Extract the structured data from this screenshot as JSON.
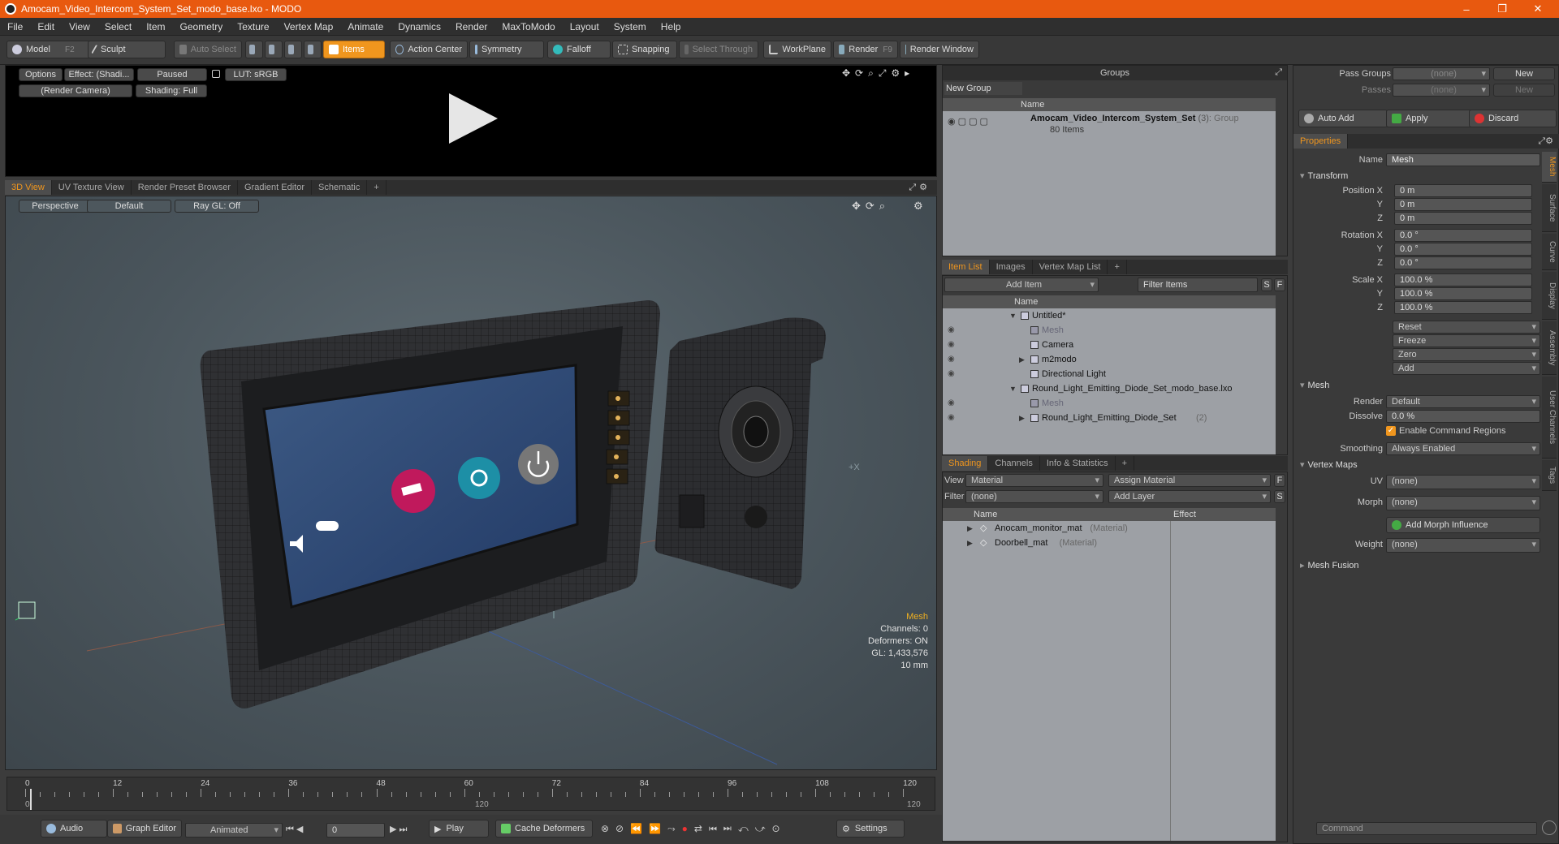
{
  "window": {
    "title": "Amocam_Video_Intercom_System_Set_modo_base.lxo - MODO",
    "minimize": "–",
    "maximize": "❐",
    "close": "✕"
  },
  "menu": [
    "File",
    "Edit",
    "View",
    "Select",
    "Item",
    "Geometry",
    "Texture",
    "Vertex Map",
    "Animate",
    "Dynamics",
    "Render",
    "MaxToModo",
    "Layout",
    "System",
    "Help"
  ],
  "toolbar": {
    "model": "Model",
    "model_key": "F2",
    "sculpt": "Sculpt",
    "auto_select": "Auto Select",
    "items": "Items",
    "action_center": "Action Center",
    "symmetry": "Symmetry",
    "falloff": "Falloff",
    "snapping": "Snapping",
    "select_through": "Select Through",
    "workplane": "WorkPlane",
    "render": "Render",
    "render_key": "F9",
    "render_window": "Render Window"
  },
  "preview": {
    "options": "Options",
    "effect": "Effect: (Shadi...",
    "paused": "Paused",
    "lut": "LUT: sRGB",
    "camera": "(Render Camera)",
    "shading": "Shading: Full"
  },
  "viewport_tabs": [
    "3D View",
    "UV Texture View",
    "Render Preset Browser",
    "Gradient Editor",
    "Schematic",
    "+"
  ],
  "viewport": {
    "projection": "Perspective",
    "style": "Default",
    "raygl": "Ray GL: Off",
    "marker": "+X",
    "info": {
      "title": "Mesh",
      "channels": "Channels: 0",
      "deformers": "Deformers: ON",
      "gl": "GL: 1,433,576",
      "scale": "10 mm"
    }
  },
  "screen_icons": {
    "mute": "Mute",
    "camera": "Camera",
    "settings": "Settings",
    "power": "Power"
  },
  "timeline": {
    "ticks": [
      "0",
      "12",
      "24",
      "36",
      "48",
      "60",
      "72",
      "84",
      "96",
      "108",
      "120"
    ],
    "bottom_ticks": [
      "0",
      "120",
      "120"
    ]
  },
  "bottombar": {
    "audio": "Audio",
    "graph_editor": "Graph Editor",
    "animated": "Animated",
    "frame": "0",
    "play": "Play",
    "cache_deformers": "Cache Deformers",
    "settings": "Settings"
  },
  "groups": {
    "title": "Groups",
    "new_group": "New Group",
    "col_name": "Name",
    "item_name": "Amocam_Video_Intercom_System_Set",
    "item_count": "(3)",
    "item_type": ": Group",
    "item_sub": "80 Items"
  },
  "itemlist": {
    "tabs": [
      "Item List",
      "Images",
      "Vertex Map List",
      "+"
    ],
    "add_item": "Add Item",
    "filter_items": "Filter Items",
    "s": "S",
    "f": "F",
    "col_name": "Name",
    "items": [
      {
        "label": "Untitled*",
        "indent": 0,
        "arrow": "▼",
        "dim": false
      },
      {
        "label": "Mesh",
        "indent": 1,
        "arrow": "",
        "dim": true
      },
      {
        "label": "Camera",
        "indent": 1,
        "arrow": "",
        "dim": false
      },
      {
        "label": "m2modo",
        "indent": 1,
        "arrow": "▶",
        "dim": false
      },
      {
        "label": "Directional Light",
        "indent": 1,
        "arrow": "",
        "dim": false
      },
      {
        "label": "Round_Light_Emitting_Diode_Set_modo_base.lxo",
        "indent": 0,
        "arrow": "▼",
        "dim": false
      },
      {
        "label": "Mesh",
        "indent": 1,
        "arrow": "",
        "dim": true
      },
      {
        "label": "Round_Light_Emitting_Diode_Set",
        "indent": 1,
        "arrow": "▶",
        "dim": false,
        "count": "(2)"
      }
    ]
  },
  "shading": {
    "tabs": [
      "Shading",
      "Channels",
      "Info & Statistics",
      "+"
    ],
    "view_label": "View",
    "view_value": "Material",
    "assign_material": "Assign Material",
    "filter_label": "Filter",
    "filter_value": "(none)",
    "add_layer": "Add Layer",
    "col_name": "Name",
    "col_effect": "Effect",
    "items": [
      {
        "name": "Anocam_monitor_mat",
        "type": "(Material)"
      },
      {
        "name": "Doorbell_mat",
        "type": "(Material)"
      }
    ]
  },
  "properties": {
    "pass_groups_label": "Pass Groups",
    "pass_groups_value": "(none)",
    "new": "New",
    "passes_label": "Passes",
    "passes_value": "(none)",
    "new2": "New",
    "auto_add": "Auto Add",
    "apply": "Apply",
    "discard": "Discard",
    "tab": "Properties",
    "name_label": "Name",
    "name_value": "Mesh",
    "transform": "Transform",
    "position": [
      {
        "l": "Position X",
        "v": "0 m"
      },
      {
        "l": "Y",
        "v": "0 m"
      },
      {
        "l": "Z",
        "v": "0 m"
      }
    ],
    "rotation": [
      {
        "l": "Rotation X",
        "v": "0.0 °"
      },
      {
        "l": "Y",
        "v": "0.0 °"
      },
      {
        "l": "Z",
        "v": "0.0 °"
      }
    ],
    "scale": [
      {
        "l": "Scale X",
        "v": "100.0 %"
      },
      {
        "l": "Y",
        "v": "100.0 %"
      },
      {
        "l": "Z",
        "v": "100.0 %"
      }
    ],
    "actions": [
      "Reset",
      "Freeze",
      "Zero",
      "Add"
    ],
    "mesh": "Mesh",
    "render_label": "Render",
    "render_value": "Default",
    "dissolve_label": "Dissolve",
    "dissolve_value": "0.0 %",
    "enable_cmd": "Enable Command Regions",
    "smoothing_label": "Smoothing",
    "smoothing_value": "Always Enabled",
    "vertex_maps": "Vertex Maps",
    "uv_label": "UV",
    "uv_value": "(none)",
    "morph_label": "Morph",
    "morph_value": "(none)",
    "add_morph": "Add Morph Influence",
    "weight_label": "Weight",
    "weight_value": "(none)",
    "mesh_fusion": "Mesh Fusion",
    "side_tabs": [
      "Mesh",
      "Surface",
      "Curve",
      "Display",
      "Assembly",
      "User Channels",
      "Tags"
    ],
    "command": "Command"
  },
  "colors": {
    "accent": "#f0961e",
    "title": "#e8590f"
  }
}
